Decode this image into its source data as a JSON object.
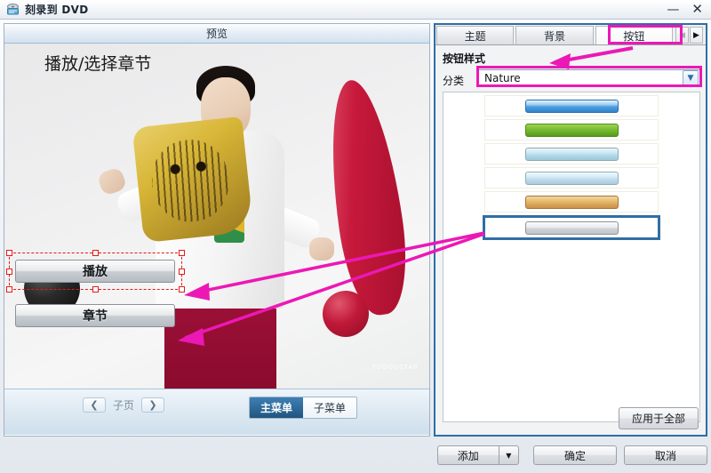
{
  "window": {
    "title": "刻录到 DVD",
    "icon": "dvd-burner-icon",
    "minimize_label": "—",
    "close_label": "✕"
  },
  "preview": {
    "header": "预览",
    "menu_title": "播放/选择章节",
    "buttons": [
      {
        "label": "播放",
        "selected": true
      },
      {
        "label": "章节",
        "selected": false
      }
    ],
    "watermark": "TUDOUSTAR",
    "footer": {
      "prev_arrow": "❮",
      "subpage_label": "子页",
      "next_arrow": "❯",
      "menu_tabs": [
        {
          "label": "主菜单",
          "active": true
        },
        {
          "label": "子菜单",
          "active": false
        }
      ]
    }
  },
  "panel": {
    "tabs": [
      {
        "label": "主题",
        "active": false
      },
      {
        "label": "背景",
        "active": false
      },
      {
        "label": "按钮",
        "active": true
      }
    ],
    "tab_nav": {
      "prev": "◀",
      "next": "▶"
    },
    "section_title": "按钮样式",
    "category_label": "分类",
    "category_value": "Nature",
    "category_arrow": "▼",
    "styles": [
      {
        "name": "blue-button-style",
        "color": "#4d9ede",
        "selected": false
      },
      {
        "name": "green-button-style",
        "color": "#6fb52c",
        "selected": false
      },
      {
        "name": "lightblue-button-style",
        "color": "#b4d8e8",
        "selected": false
      },
      {
        "name": "paleblue-button-style",
        "color": "#bfdcea",
        "selected": false
      },
      {
        "name": "tan-button-style",
        "color": "#dfab5c",
        "selected": false
      },
      {
        "name": "gray-button-style",
        "color": "#cfd2d4",
        "selected": true
      }
    ],
    "apply_all_label": "应用于全部"
  },
  "actions": {
    "add_label": "添加",
    "add_dropdown_arrow": "▼",
    "ok_label": "确定",
    "cancel_label": "取消"
  },
  "colors": {
    "annotation": "#ec18b5",
    "selection_blue": "#2f6ea5",
    "selection_red": "#e21b1b",
    "accent_blue": "#3f7fb5"
  }
}
